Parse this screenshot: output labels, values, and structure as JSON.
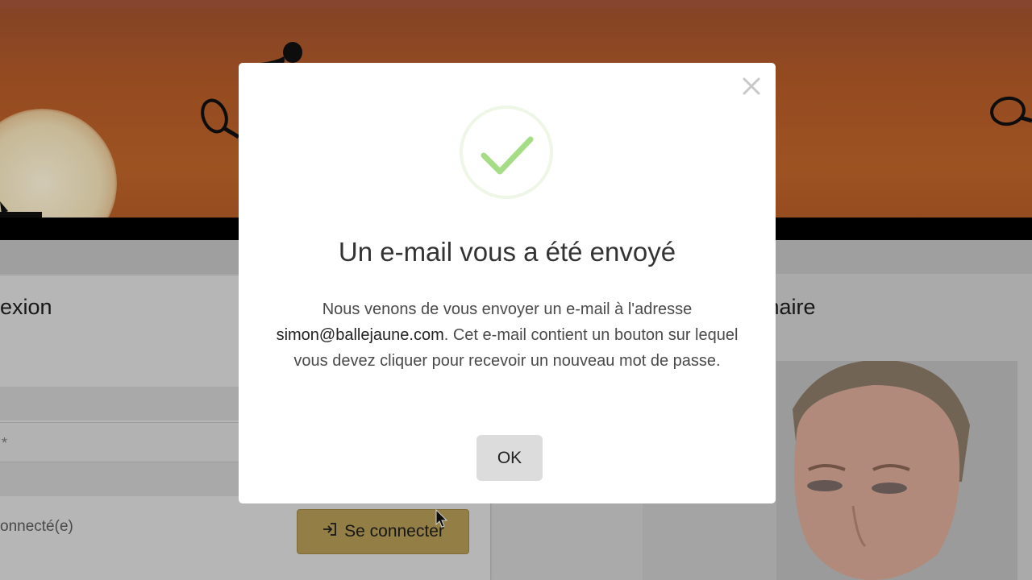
{
  "background": {
    "login_title": "exion",
    "field_asterisk": "*",
    "remember_text": "onnecté(e)",
    "connect_button_label": "Se connecter",
    "partner_title": "rtenaire"
  },
  "modal": {
    "title": "Un e-mail vous a été envoyé",
    "body_intro": "Nous venons de vous envoyer un e-mail à l'adresse",
    "email": "simon@ballejaune.com",
    "body_rest": ". Cet e-mail contient un bouton sur lequel vous devez cliquer pour recevoir un nouveau mot de passe.",
    "ok_label": "OK"
  },
  "icons": {
    "close": "close-icon",
    "success": "checkmark-icon",
    "login": "login-icon",
    "cursor": "mouse-cursor-icon"
  },
  "colors": {
    "banner": "#b65c28",
    "connect_button": "#b49a55",
    "checkmark": "#a5dc86",
    "ok_button": "#dcdcdc"
  }
}
